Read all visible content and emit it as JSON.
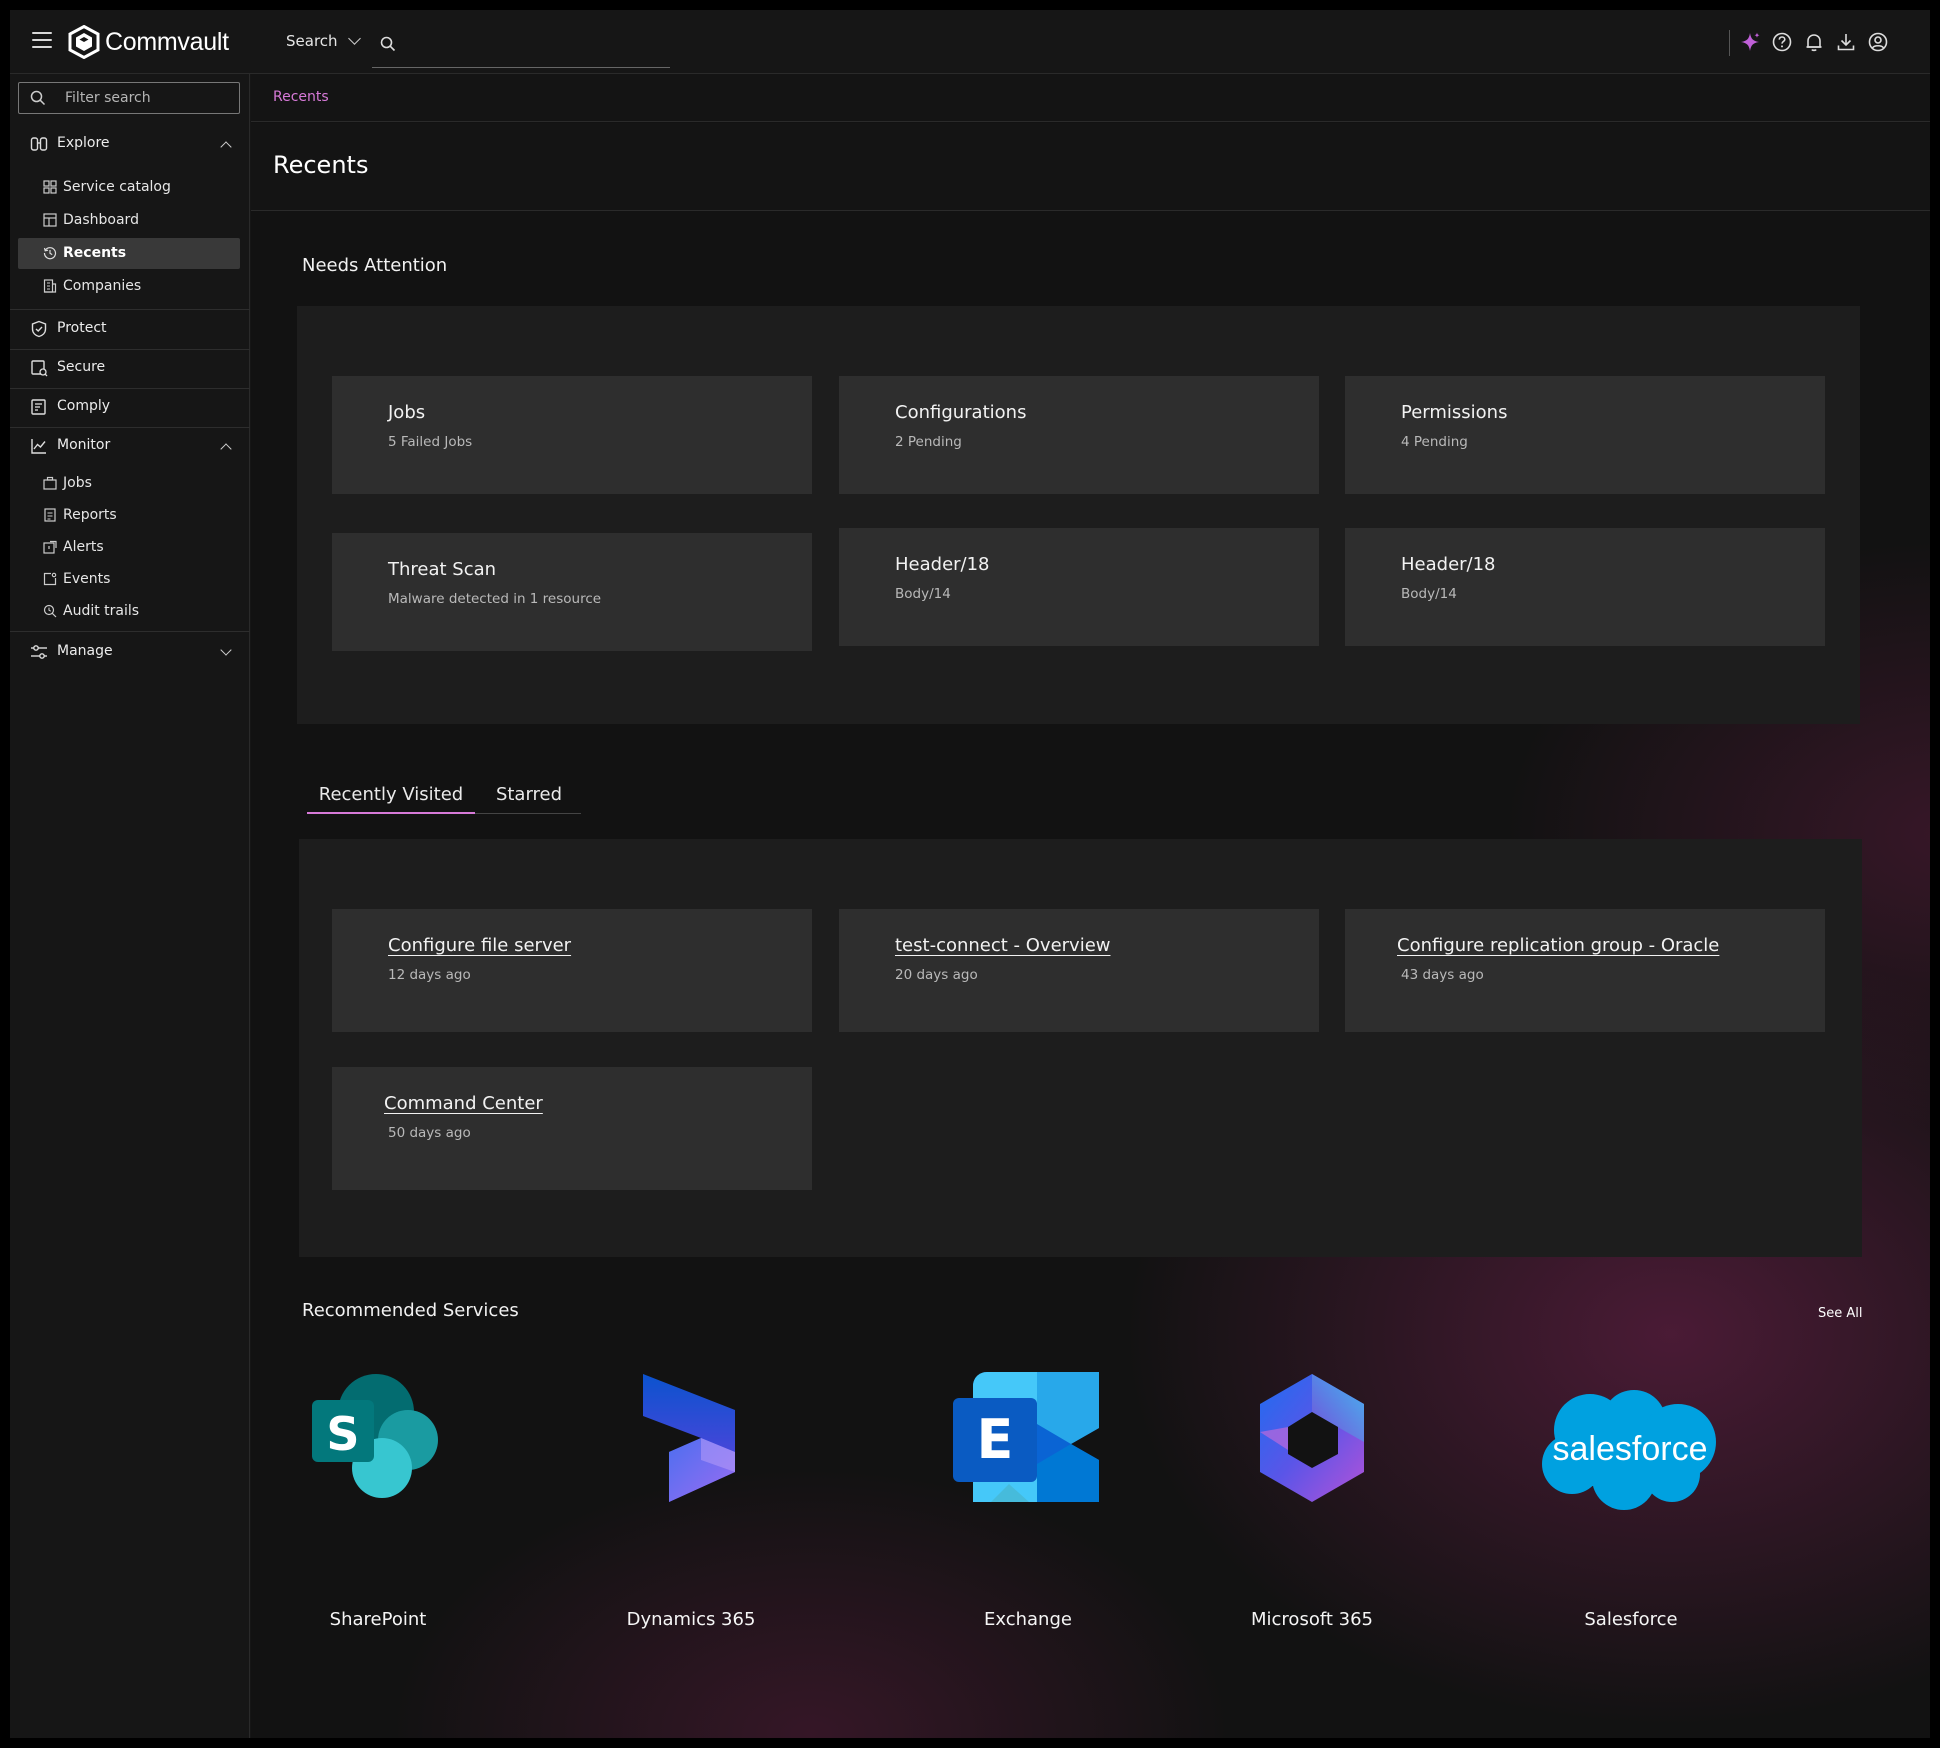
{
  "app": {
    "brand": "Commvault"
  },
  "topbar": {
    "search_scope": "Search",
    "search_value": "",
    "icons": [
      "menu-icon",
      "sparkle-icon",
      "help-icon",
      "bell-icon",
      "download-icon",
      "user-icon"
    ]
  },
  "sidebar": {
    "filter_placeholder": "Filter search",
    "explore": {
      "label": "Explore",
      "items": [
        {
          "label": "Service catalog",
          "icon": "grid-icon"
        },
        {
          "label": "Dashboard",
          "icon": "dashboard-icon"
        },
        {
          "label": "Recents",
          "icon": "history-icon",
          "active": true
        },
        {
          "label": "Companies",
          "icon": "building-icon"
        }
      ]
    },
    "protect": {
      "label": "Protect"
    },
    "secure": {
      "label": "Secure"
    },
    "comply": {
      "label": "Comply"
    },
    "monitor": {
      "label": "Monitor",
      "items": [
        {
          "label": "Jobs",
          "icon": "briefcase-icon"
        },
        {
          "label": "Reports",
          "icon": "report-icon"
        },
        {
          "label": "Alerts",
          "icon": "alert-icon"
        },
        {
          "label": "Events",
          "icon": "events-icon"
        },
        {
          "label": "Audit trails",
          "icon": "audit-icon"
        }
      ]
    },
    "manage": {
      "label": "Manage"
    }
  },
  "breadcrumb": {
    "label": "Recents"
  },
  "page": {
    "title": "Recents"
  },
  "needs_attention": {
    "title": "Needs Attention",
    "cards": [
      {
        "title": "Jobs",
        "subtitle": "5 Failed Jobs"
      },
      {
        "title": "Configurations",
        "subtitle": "2 Pending"
      },
      {
        "title": "Permissions",
        "subtitle": "4 Pending"
      },
      {
        "title": "Threat Scan",
        "subtitle": "Malware detected in 1 resource"
      },
      {
        "title": "Header/18",
        "subtitle": "Body/14"
      },
      {
        "title": "Header/18",
        "subtitle": "Body/14"
      }
    ]
  },
  "tabs": {
    "active": "Recently Visited",
    "items": [
      {
        "label": "Recently Visited"
      },
      {
        "label": "Starred"
      }
    ]
  },
  "recently_visited": {
    "cards": [
      {
        "title": "Configure file server",
        "subtitle": "12 days ago"
      },
      {
        "title": "test-connect - Overview",
        "subtitle": "20 days ago"
      },
      {
        "title": "Configure replication group - Oracle",
        "subtitle": "43 days ago"
      },
      {
        "title": "Command Center",
        "subtitle": "50 days ago"
      }
    ]
  },
  "recommended": {
    "title": "Recommended Services",
    "see_all": "See All",
    "services": [
      {
        "label": "SharePoint",
        "icon": "sharepoint-logo"
      },
      {
        "label": "Dynamics 365",
        "icon": "dynamics-365-logo"
      },
      {
        "label": "Exchange",
        "icon": "exchange-logo"
      },
      {
        "label": "Microsoft 365",
        "icon": "microsoft-365-logo"
      },
      {
        "label": "Salesforce",
        "icon": "salesforce-logo",
        "logo_text": "salesforce"
      }
    ]
  },
  "colors": {
    "accent": "#d77ad8",
    "card": "#2e2e2e",
    "panel": "#1d1d1d",
    "background": "#121212"
  }
}
